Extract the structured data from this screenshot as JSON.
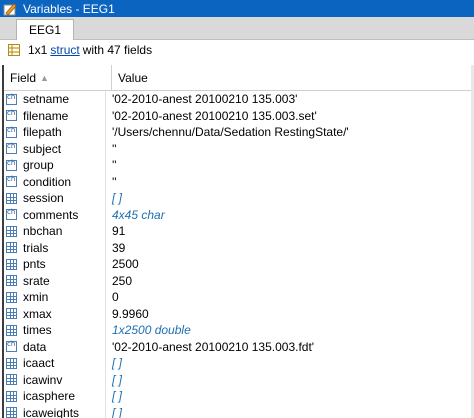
{
  "window": {
    "title": "Variables - EEG1"
  },
  "tabs": [
    {
      "label": "EEG1"
    }
  ],
  "summary": {
    "prefix": "1x1",
    "type_link": "struct",
    "suffix": "with 47 fields"
  },
  "table": {
    "headers": {
      "field": "Field",
      "value": "Value"
    },
    "rows": [
      {
        "icon": "char-icon",
        "field": "setname",
        "value": "'02-2010-anest 20100210 135.003'",
        "style": "plain"
      },
      {
        "icon": "char-icon",
        "field": "filename",
        "value": "'02-2010-anest 20100210 135.003.set'",
        "style": "plain"
      },
      {
        "icon": "char-icon",
        "field": "filepath",
        "value": "'/Users/chennu/Data/Sedation RestingState/'",
        "style": "plain"
      },
      {
        "icon": "char-icon",
        "field": "subject",
        "value": "''",
        "style": "plain"
      },
      {
        "icon": "char-icon",
        "field": "group",
        "value": "''",
        "style": "plain"
      },
      {
        "icon": "char-icon",
        "field": "condition",
        "value": "''",
        "style": "plain"
      },
      {
        "icon": "grid-icon",
        "field": "session",
        "value": "[ ]",
        "style": "italic"
      },
      {
        "icon": "char-icon",
        "field": "comments",
        "value": "4x45 char",
        "style": "italic"
      },
      {
        "icon": "grid-icon",
        "field": "nbchan",
        "value": "91",
        "style": "plain"
      },
      {
        "icon": "grid-icon",
        "field": "trials",
        "value": "39",
        "style": "plain"
      },
      {
        "icon": "grid-icon",
        "field": "pnts",
        "value": "2500",
        "style": "plain"
      },
      {
        "icon": "grid-icon",
        "field": "srate",
        "value": "250",
        "style": "plain"
      },
      {
        "icon": "grid-icon",
        "field": "xmin",
        "value": "0",
        "style": "plain"
      },
      {
        "icon": "grid-icon",
        "field": "xmax",
        "value": "9.9960",
        "style": "plain"
      },
      {
        "icon": "grid-icon",
        "field": "times",
        "value": "1x2500 double",
        "style": "italic"
      },
      {
        "icon": "char-icon",
        "field": "data",
        "value": "'02-2010-anest 20100210 135.003.fdt'",
        "style": "plain"
      },
      {
        "icon": "grid-icon",
        "field": "icaact",
        "value": "[ ]",
        "style": "italic"
      },
      {
        "icon": "grid-icon",
        "field": "icawinv",
        "value": "[ ]",
        "style": "italic"
      },
      {
        "icon": "grid-icon",
        "field": "icasphere",
        "value": "[ ]",
        "style": "italic"
      },
      {
        "icon": "grid-icon",
        "field": "icaweights",
        "value": "[ ]",
        "style": "italic"
      }
    ]
  }
}
